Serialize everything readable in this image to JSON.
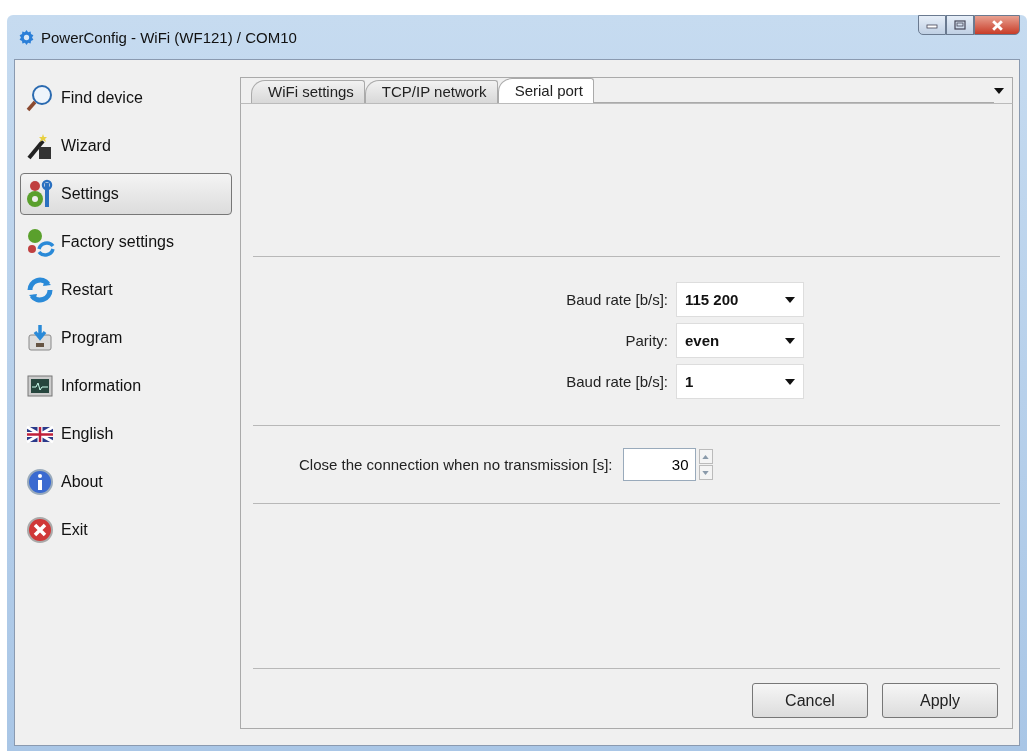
{
  "window": {
    "title": "PowerConfig - WiFi (WF121) / COM10"
  },
  "sidebar": {
    "items": [
      {
        "label": "Find device",
        "kind": "search",
        "selected": false
      },
      {
        "label": "Wizard",
        "kind": "wand",
        "selected": false
      },
      {
        "label": "Settings",
        "kind": "gears",
        "selected": true
      },
      {
        "label": "Factory settings",
        "kind": "factory",
        "selected": false
      },
      {
        "label": "Restart",
        "kind": "restart",
        "selected": false
      },
      {
        "label": "Program",
        "kind": "program",
        "selected": false
      },
      {
        "label": "Information",
        "kind": "monitor",
        "selected": false
      },
      {
        "label": "English",
        "kind": "flag",
        "selected": false
      },
      {
        "label": "About",
        "kind": "info",
        "selected": false
      },
      {
        "label": "Exit",
        "kind": "exit",
        "selected": false
      }
    ]
  },
  "tabs": [
    {
      "label": "WiFi settings",
      "selected": false
    },
    {
      "label": "TCP/IP network",
      "selected": false
    },
    {
      "label": "Serial port",
      "selected": true
    }
  ],
  "serial_fields": [
    {
      "label": "Baud rate [b/s]:",
      "value": "115 200"
    },
    {
      "label": "Parity:",
      "value": "even"
    },
    {
      "label": "Baud rate [b/s]:",
      "value": "1"
    }
  ],
  "timeout": {
    "label": "Close the connection when no transmission [s]:",
    "value": "30"
  },
  "buttons": [
    "Cancel",
    "Apply"
  ]
}
